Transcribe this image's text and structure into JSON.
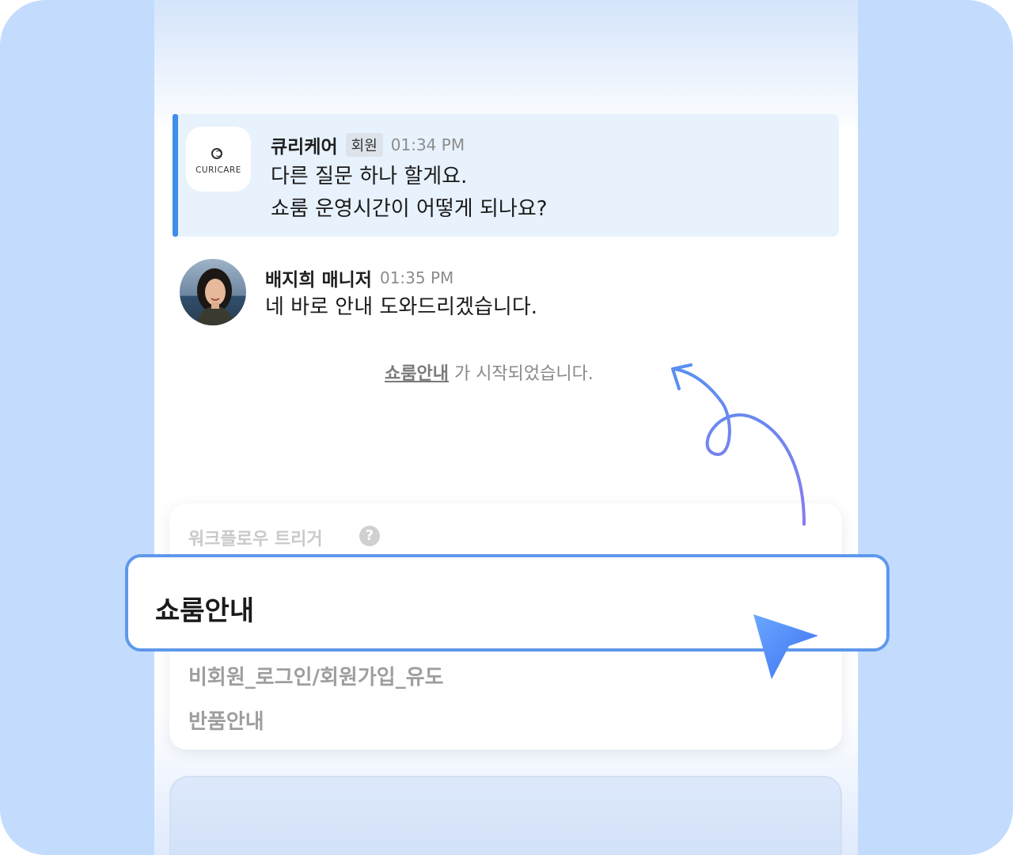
{
  "messages": [
    {
      "logo_text": "CURICARE",
      "sender": "큐리케어",
      "badge": "회원",
      "time": "01:34 PM",
      "lines": [
        "다른 질문 하나 할게요.",
        "쇼룸 운영시간이 어떻게 되나요?"
      ]
    },
    {
      "sender": "배지희 매니저",
      "time": "01:35 PM",
      "lines": [
        "네 바로 안내 도와드리겠습니다."
      ]
    }
  ],
  "system": {
    "link_text": "쇼룸안내",
    "suffix": " 가 시작되었습니다."
  },
  "workflow": {
    "title": "워크플로우 트리거",
    "help_icon": "question-mark-icon",
    "selected_option": "쇼룸안내",
    "options": [
      "비회원_로그인/회원가입_유도",
      "반품안내"
    ]
  },
  "colors": {
    "background": "#c3dcfd",
    "accent": "#3d8fea",
    "selection_border": "#5f98ec",
    "cursor": "#4a86f0"
  }
}
